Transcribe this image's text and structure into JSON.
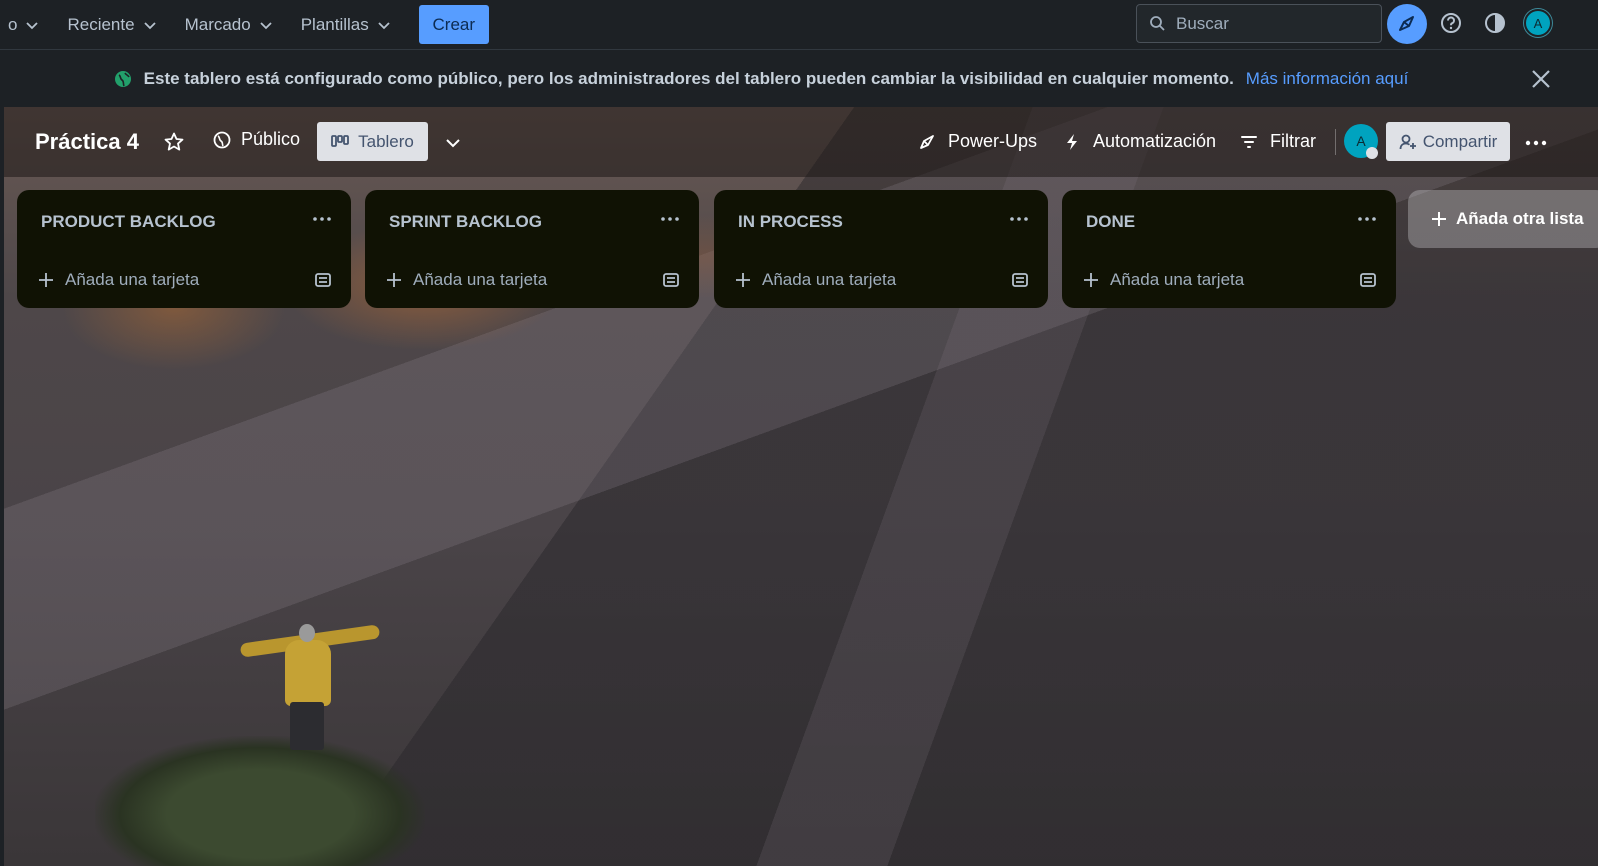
{
  "topnav": {
    "items": [
      {
        "label": "o"
      },
      {
        "label": "Reciente"
      },
      {
        "label": "Marcado"
      },
      {
        "label": "Plantillas"
      }
    ],
    "create_label": "Crear",
    "search_placeholder": "Buscar",
    "user_initial": "A"
  },
  "banner": {
    "text": "Este tablero está configurado como público, pero los administradores del tablero pueden cambiar la visibilidad en cualquier momento.",
    "link": "Más información aquí"
  },
  "board": {
    "title": "Práctica 4",
    "visibility": "Público",
    "view": "Tablero",
    "actions": {
      "powerups": "Power-Ups",
      "automation": "Automatización",
      "filter": "Filtrar",
      "share": "Compartir"
    },
    "member_initial": "A"
  },
  "lists": [
    {
      "title": "PRODUCT BACKLOG",
      "add_card": "Añada una tarjeta"
    },
    {
      "title": "SPRINT BACKLOG",
      "add_card": "Añada una tarjeta"
    },
    {
      "title": "IN PROCESS",
      "add_card": "Añada una tarjeta"
    },
    {
      "title": "DONE",
      "add_card": "Añada una tarjeta"
    }
  ],
  "add_list_label": "Añada otra lista",
  "colors": {
    "accent": "#579dff",
    "nav_bg": "#1d2125",
    "list_bg": "#101204",
    "avatar": "#00a3bf",
    "banner_icon": "#22a06b"
  }
}
